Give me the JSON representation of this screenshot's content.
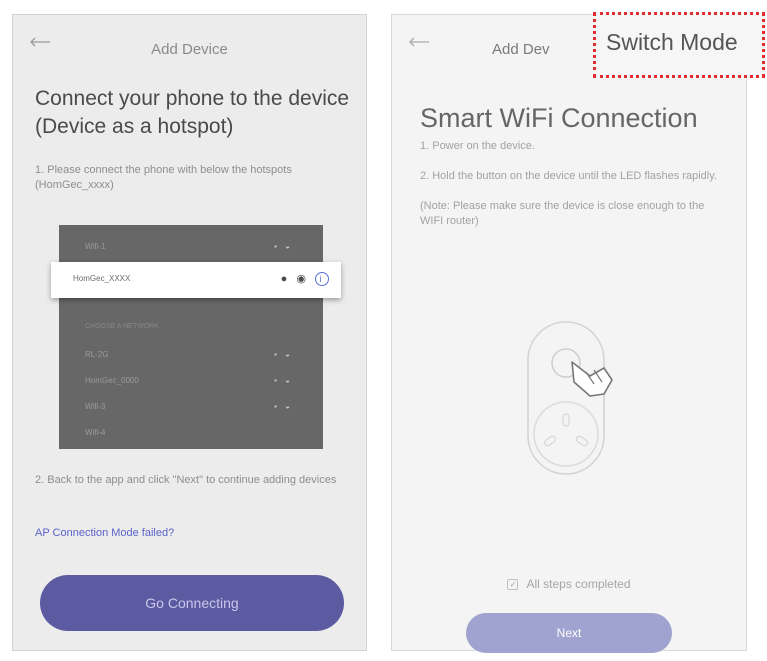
{
  "left": {
    "header_title": "Add Device",
    "heading": "Connect your phone to the device (Device as a hotspot)",
    "step1": "1. Please connect the phone with below the hotspots (HomGec_xxxx)",
    "wifi_list": {
      "selected": {
        "name": "HomGec_XXXX"
      },
      "rows": [
        {
          "name": "Wifi-1"
        },
        {
          "name": "RL-2G"
        },
        {
          "name": "HomGec_0000"
        },
        {
          "name": "Wifi-3"
        },
        {
          "name": "Wifi-4"
        }
      ],
      "section_label": "CHOOSE A NETWORK"
    },
    "step2": "2. Back to the app and click \"Next\" to continue adding devices",
    "ap_failed_link": "AP Connection Mode failed?",
    "go_connecting_label": "Go Connecting"
  },
  "right": {
    "header_title": "Add Dev",
    "switch_mode_label": "Switch Mode",
    "heading": "Smart WiFi Connection",
    "step1": "1. Power on the device.",
    "step2": "2. Hold the button on the device until the LED flashes rapidly.",
    "note": "(Note: Please make sure the device is close enough to the WIFI router)",
    "all_steps_label": "All steps completed",
    "next_label": "Next"
  },
  "icons": {
    "back": "back-arrow-icon",
    "hand": "hand-pointer-icon",
    "check": "checkbox-icon",
    "info": "info-icon",
    "lock": "lock-icon",
    "wifi": "wifi-signal-icon"
  },
  "colors": {
    "primary_button": "#5c5aa1",
    "next_button": "#a0a2cf",
    "link": "#5b63c9",
    "highlight_border": "#e02d2d"
  }
}
